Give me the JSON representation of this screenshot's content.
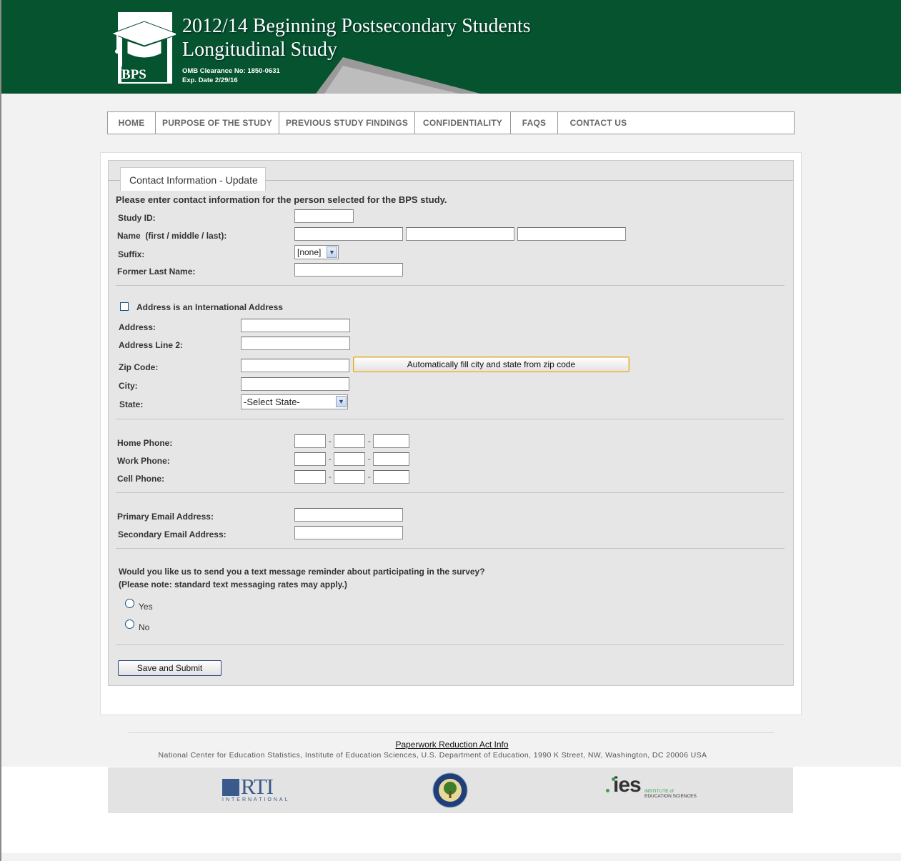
{
  "header": {
    "logo_text": "BPS",
    "title_line1": "2012/14 Beginning Postsecondary Students",
    "title_line2": "Longitudinal Study",
    "omb_clearance": "OMB Clearance No: 1850-0631",
    "exp_date": "Exp. Date 2/29/16"
  },
  "nav": {
    "items": [
      {
        "label": "HOME"
      },
      {
        "label": "PURPOSE OF THE STUDY"
      },
      {
        "label": "PREVIOUS STUDY FINDINGS"
      },
      {
        "label": "CONFIDENTIALITY"
      },
      {
        "label": "FAQS"
      },
      {
        "label": "CONTACT US"
      }
    ]
  },
  "form": {
    "tab_title": "Contact Information - Update",
    "intro": "Please enter contact information for the person selected for the BPS study.",
    "study_id_label": "Study ID:",
    "name_label": "Name  (first / middle / last):",
    "suffix_label": "Suffix:",
    "suffix_value": "[none]",
    "former_last_name_label": "Former Last Name:",
    "intl_address_label": "Address is an International Address",
    "address_label": "Address:",
    "address2_label": "Address Line 2:",
    "zip_label": "Zip Code:",
    "autofill_button": "Automatically fill city and state from zip code",
    "city_label": "City:",
    "state_label": "State:",
    "state_value": "-Select State-",
    "home_phone_label": "Home Phone:",
    "work_phone_label": "Work Phone:",
    "cell_phone_label": "Cell Phone:",
    "phone_separator": "-",
    "primary_email_label": "Primary Email Address:",
    "secondary_email_label": "Secondary Email Address:",
    "text_question": "Would you like us to send you a text message reminder about participating in the survey?",
    "text_note": "(Please note: standard text messaging rates may apply.)",
    "yes_label": "Yes",
    "no_label": "No",
    "submit_button": "Save and Submit"
  },
  "footer": {
    "paperwork_link": "Paperwork Reduction Act Info",
    "address": "National Center for Education Statistics, Institute of Education Sciences, U.S. Department of Education, 1990 K Street, NW, Washington, DC 20006 USA",
    "rti_text": "RTI",
    "rti_sub": "INTERNATIONAL",
    "ies_text": "ies",
    "ies_sub1": "INSTITUTE of",
    "ies_sub2": "EDUCATION SCIENCES"
  },
  "colors": {
    "header_green": "#05532f",
    "rti_blue": "#3a5a8c",
    "ies_green": "#3aa344"
  }
}
